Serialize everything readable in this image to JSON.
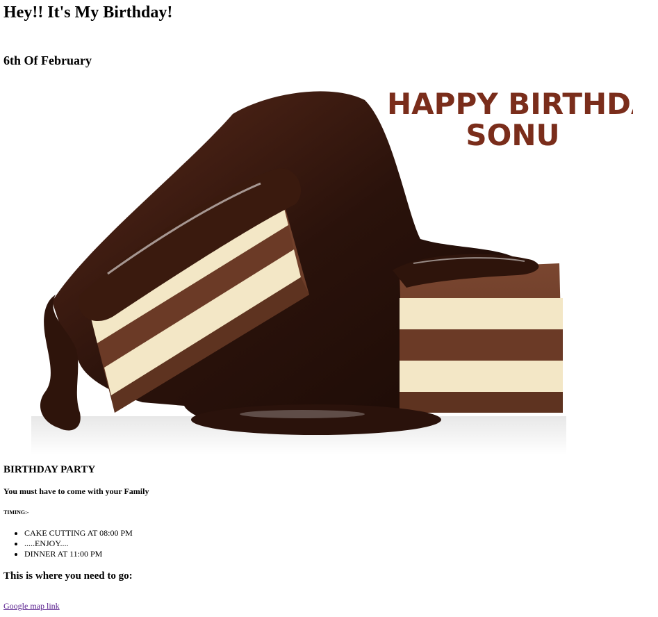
{
  "page": {
    "heading": "Hey!! It's My Birthday!",
    "date": "6th Of February"
  },
  "hero_image": {
    "subject": "chocolate-layer-cake-with-chocolate-drizzle",
    "overlay_line1": "HAPPY BIRTHDAY",
    "overlay_line2": "SONU",
    "overlay_color": "#7a2d1b"
  },
  "party": {
    "heading": "BIRTHDAY PARTY",
    "note": "You must have to come with your Family",
    "timing_label": "TIMING:-",
    "schedule": [
      "CAKE CUTTING AT 08:00 PM",
      ".....ENJOY....",
      "DINNER AT 11:00 PM"
    ]
  },
  "location": {
    "heading": "This is where you need to go:",
    "link_text": "Google map link"
  },
  "colors": {
    "visited_link": "#551a8b",
    "chocolate_dark": "#2a120b",
    "chocolate_mid": "#6b3a26",
    "cream": "#f5ecd0"
  }
}
